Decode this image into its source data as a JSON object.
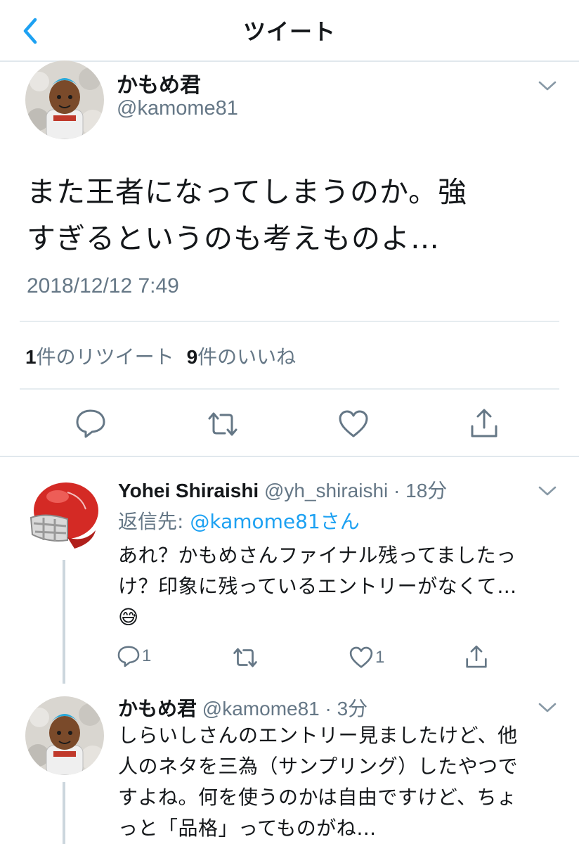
{
  "nav": {
    "title": "ツイート",
    "back_icon": "chevron-left-icon",
    "accent": "#1da1f2"
  },
  "tweet": {
    "name": "かもめ君",
    "handle": "@kamome81",
    "text_line1": "また王者になってしまうのか。強",
    "text_line2": "すぎるというのも考えものよ…",
    "timestamp": "2018/12/12 7:49",
    "retweet_count": "1",
    "retweet_label": "件のリツイート",
    "like_count": "9",
    "like_label": "件のいいね"
  },
  "replies": [
    {
      "name": "Yohei Shiraishi",
      "handle_time": "@yh_shiraishi · 18分",
      "reply_to_label": "返信先: ",
      "reply_to_mention": "@kamome81さん",
      "lines": [
        "あれ？かもめさんファイナル残ってましたっ",
        "け？印象に残っているエントリーがなくて…",
        "😅"
      ],
      "reply_count": "1",
      "like_count": "1"
    },
    {
      "name": "かもめ君",
      "handle_time": "@kamome81 · 3分",
      "lines": [
        "しらいしさんのエントリー見ましたけど、他",
        "人のネタを三為（サンプリング）したやつで",
        "すよね。何を使うのかは自由ですけど、ちょ",
        "っと「品格」ってものがね…"
      ]
    }
  ],
  "colors": {
    "text": "#14171a",
    "secondary": "#657786",
    "link": "#1da1f2",
    "border": "#e6ecf0"
  }
}
